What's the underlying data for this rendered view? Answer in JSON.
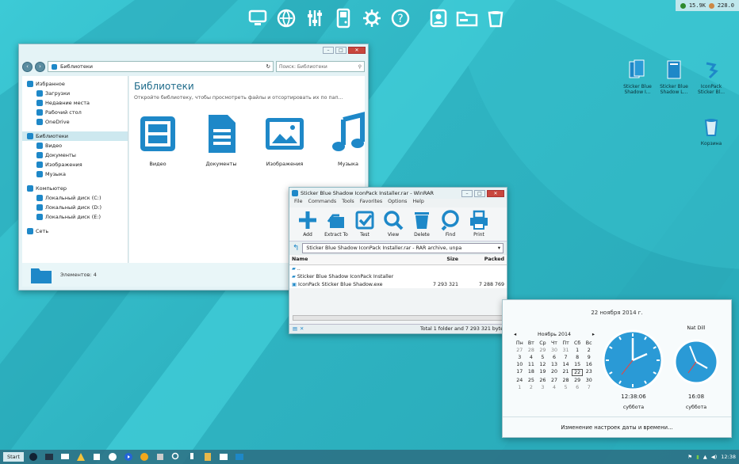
{
  "status_bar": {
    "mem": "15.9K",
    "cpu": "228.0"
  },
  "dock_icons": [
    "monitor-icon",
    "globe-icon",
    "sliders-icon",
    "gameboy-icon",
    "gear-icon",
    "help-icon",
    "user-card-icon",
    "folder-icon",
    "bin-icon"
  ],
  "desktop": {
    "icons": [
      {
        "label": "Sticker Blue Shadow I..."
      },
      {
        "label": "Sticker Blue Shadow L..."
      },
      {
        "label": "IconPack Sticker Bl..."
      },
      {
        "label": "Корзина"
      }
    ]
  },
  "explorer": {
    "address": "Библиотеки",
    "search_placeholder": "Поиск: Библиотеки",
    "title": "Библиотеки",
    "hint": "Откройте библиотеку, чтобы просмотреть файлы и отсортировать их по пап...",
    "nav": [
      {
        "label": "Избранное",
        "level": 0
      },
      {
        "label": "Загрузки",
        "level": 1
      },
      {
        "label": "Недавние места",
        "level": 1
      },
      {
        "label": "Рабочий стол",
        "level": 1
      },
      {
        "label": "OneDrive",
        "level": 1
      },
      {
        "label": "Библиотеки",
        "level": 0
      },
      {
        "label": "Видео",
        "level": 1
      },
      {
        "label": "Документы",
        "level": 1
      },
      {
        "label": "Изображения",
        "level": 1
      },
      {
        "label": "Музыка",
        "level": 1
      },
      {
        "label": "Компьютер",
        "level": 0
      },
      {
        "label": "Локальный диск (C:)",
        "level": 1
      },
      {
        "label": "Локальный диск (D:)",
        "level": 1
      },
      {
        "label": "Локальный диск (E:)",
        "level": 1
      },
      {
        "label": "Сеть",
        "level": 0
      }
    ],
    "libraries": [
      "Видео",
      "Документы",
      "Изображения",
      "Музыка"
    ],
    "status": "Элементов: 4"
  },
  "winrar": {
    "title": "Sticker Blue Shadow IconPack Installer.rar - WinRAR",
    "menu": [
      "File",
      "Commands",
      "Tools",
      "Favorites",
      "Options",
      "Help"
    ],
    "tools": [
      "Add",
      "Extract To",
      "Test",
      "View",
      "Delete",
      "Find",
      "Print"
    ],
    "path": "Sticker Blue Shadow IconPack Installer.rar - RAR archive, unpa",
    "columns": [
      "Name",
      "Size",
      "Packed"
    ],
    "rows": [
      {
        "name": "..",
        "size": "",
        "packed": ""
      },
      {
        "name": "Sticker Blue Shadow IconPack Installer",
        "size": "",
        "packed": ""
      },
      {
        "name": "IconPack Sticker Blue Shadow.exe",
        "size": "7 293 321",
        "packed": "7 288 769"
      }
    ],
    "status": "Total 1 folder and 7 293 321 byte"
  },
  "clock": {
    "date_long": "22 ноября 2014 г.",
    "month": "Ноябрь 2014",
    "weekdays": [
      "Пн",
      "Вт",
      "Ср",
      "Чт",
      "Пт",
      "Сб",
      "Вс"
    ],
    "weeks": [
      [
        "27",
        "28",
        "29",
        "30",
        "31",
        "1",
        "2"
      ],
      [
        "3",
        "4",
        "5",
        "6",
        "7",
        "8",
        "9"
      ],
      [
        "10",
        "11",
        "12",
        "13",
        "14",
        "15",
        "16"
      ],
      [
        "17",
        "18",
        "19",
        "20",
        "21",
        "22",
        "23"
      ],
      [
        "24",
        "25",
        "26",
        "27",
        "28",
        "29",
        "30"
      ],
      [
        "1",
        "2",
        "3",
        "4",
        "5",
        "6",
        "7"
      ]
    ],
    "today": "22",
    "clock1_time": "12:38:06",
    "clock1_day": "суббота",
    "clock2_label": "Nat Dill",
    "clock2_time": "16:08",
    "clock2_day": "суббота",
    "change_link": "Изменение настроек даты и времени..."
  },
  "taskbar": {
    "start": "Start",
    "time": "12:38"
  },
  "colors": {
    "accent": "#1e88c8",
    "wall": "#35bfcc"
  }
}
